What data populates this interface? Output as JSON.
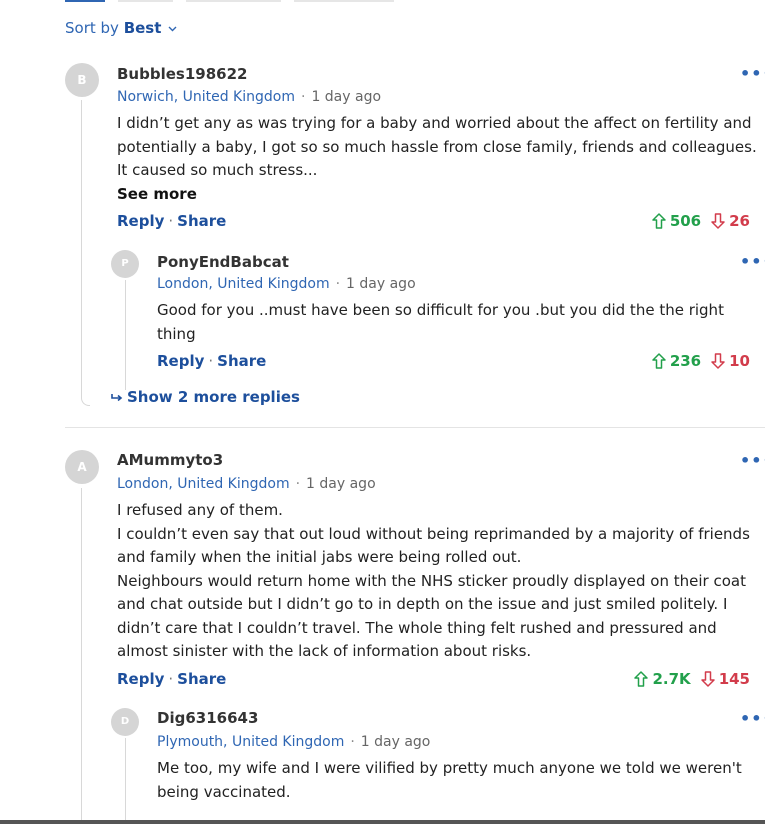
{
  "sort": {
    "prefix": "Sort by",
    "value": "Best"
  },
  "comments": [
    {
      "avatar": "B",
      "username": "Bubbles198622",
      "location": "Norwich, United Kingdom",
      "time": "1 day ago",
      "lines": [
        "I didn’t get any as was trying for a baby and worried about the affect on fertility and",
        "potentially a baby, I got so so much hassle from close family, friends and colleagues.",
        "It caused so much stress..."
      ],
      "see_more": "See more",
      "reply": "Reply",
      "share": "Share",
      "upvotes": "506",
      "downvotes": "26",
      "replies": [
        {
          "avatar": "P",
          "username": "PonyEndBabcat",
          "location": "London, United Kingdom",
          "time": "1 day ago",
          "lines": [
            "Good for you ..must have been so difficult for you .but you did the the right",
            "thing"
          ],
          "reply": "Reply",
          "share": "Share",
          "upvotes": "236",
          "downvotes": "10"
        }
      ],
      "show_more_replies": "Show 2 more replies"
    },
    {
      "avatar": "A",
      "username": "AMummyto3",
      "location": "London, United Kingdom",
      "time": "1 day ago",
      "lines": [
        "I refused any of them.",
        "I couldn’t even say that out loud without being reprimanded by a majority of friends",
        "and family when the initial jabs were being rolled out.",
        "Neighbours would return home with the NHS sticker proudly displayed on their coat",
        "and chat outside but I didn’t go to in depth on the issue and just smiled politely. I",
        "didn’t care that I couldn’t travel. The whole thing felt rushed and pressured and",
        "almost sinister with the lack of information about risks."
      ],
      "reply": "Reply",
      "share": "Share",
      "upvotes": "2.7K",
      "downvotes": "145",
      "replies": [
        {
          "avatar": "D",
          "username": "Dig6316643",
          "location": "Plymouth, United Kingdom",
          "time": "1 day ago",
          "lines": [
            "Me too, my wife and I were vilified by pretty much anyone we told we weren't",
            "being vaccinated."
          ]
        }
      ]
    }
  ],
  "colors": {
    "accent": "#2f66b3",
    "upvote": "#22a04b",
    "downvote": "#d23c4b"
  },
  "icons": {
    "more": "more-options-icon",
    "up": "arrow-up-icon",
    "down": "arrow-down-icon",
    "reply_arrow": "reply-arrow-icon"
  }
}
